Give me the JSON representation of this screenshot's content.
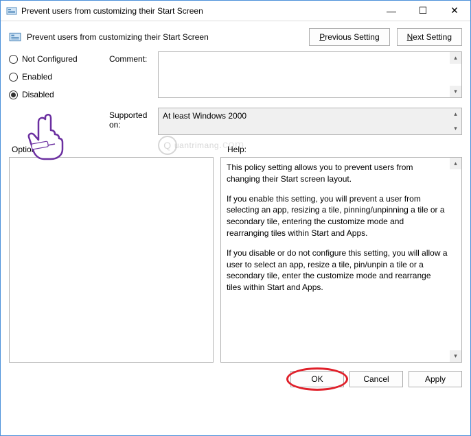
{
  "window": {
    "title": "Prevent users from customizing their Start Screen",
    "minimize": "—",
    "maximize": "☐",
    "close": "✕"
  },
  "header": {
    "title": "Prevent users from customizing their Start Screen",
    "prev_prefix": "P",
    "prev_rest": "revious Setting",
    "next_prefix": "N",
    "next_rest": "ext Setting"
  },
  "radios": {
    "not_configured": "Not Configured",
    "enabled": "Enabled",
    "disabled": "Disabled",
    "c_prefix": "C",
    "e_prefix": "E",
    "d_prefix": "D"
  },
  "labels": {
    "comment": "Comment:",
    "supported": "Supported on:",
    "options": "Options:",
    "help": "Help:"
  },
  "supported_text": "At least Windows 2000",
  "help_text": {
    "p1": "This policy setting allows you to prevent users from changing their Start screen layout.",
    "p2": "If you enable this setting, you will prevent a user from selecting an app, resizing a tile, pinning/unpinning a tile or a secondary tile, entering the customize mode and rearranging tiles within Start and Apps.",
    "p3": "If you disable or do not configure this setting, you will allow a user to select an app, resize a tile, pin/unpin a tile or a secondary tile, enter the customize mode and rearrange tiles within Start and Apps."
  },
  "footer": {
    "ok": "OK",
    "cancel": "Cancel",
    "apply": "Apply"
  },
  "watermark": "uantrimang"
}
